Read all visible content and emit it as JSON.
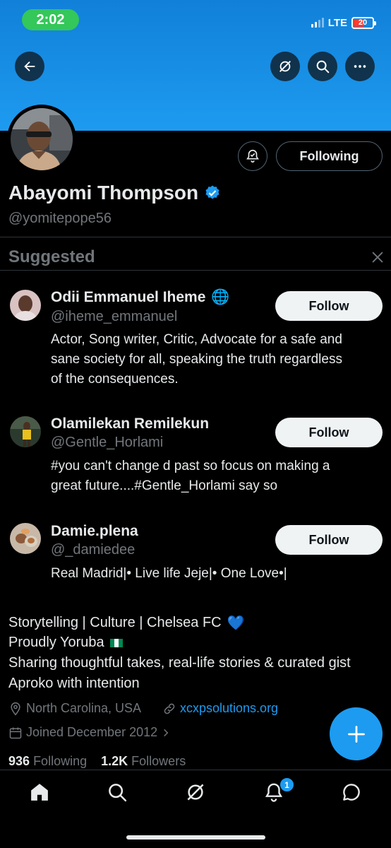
{
  "status_bar": {
    "time": "2:02",
    "network": "LTE",
    "battery": "20",
    "battery_color": "#ff3b30"
  },
  "header": {
    "back_icon": "arrow-left-icon",
    "actions": [
      "grok-icon",
      "search-icon",
      "more-icon"
    ]
  },
  "profile": {
    "name": "Abayomi Thompson",
    "verified": true,
    "handle": "@yomitepope56",
    "notify_icon": "bell-check-icon",
    "following_label": "Following"
  },
  "suggested": {
    "title": "Suggested",
    "items": [
      {
        "name": "Odii Emmanuel Iheme",
        "emoji": "🌐",
        "handle": "@iheme_emmanuel",
        "bio_lines": [
          "Actor, Song writer, Critic, Advocate for a safe and",
          "sane society for all, speaking the truth regardless",
          "of the consequences."
        ],
        "follow_label": "Follow"
      },
      {
        "name": "Olamilekan Remilekun",
        "emoji": "",
        "handle": "@Gentle_Horlami",
        "bio_lines": [
          "#you can't change d past so focus on making a",
          "great future....#Gentle_Horlami say so"
        ],
        "follow_label": "Follow"
      },
      {
        "name": "Damie.plena",
        "emoji": "",
        "handle": "@_damiedee",
        "bio_lines": [
          "Real Madrid|• Live life Jeje|• One Love•|"
        ],
        "follow_label": "Follow"
      }
    ]
  },
  "bio": {
    "line1": "Storytelling | Culture | Chelsea FC",
    "line1_emoji": "💙",
    "line2": "Proudly Yoruba",
    "line2_emoji": "🇳🇬",
    "line3": "Sharing thoughtful takes, real-life stories & curated gist",
    "line4": "Aproko with intention"
  },
  "meta": {
    "location": "North Carolina, USA",
    "website": "xcxpsolutions.org",
    "joined": "Joined December 2012"
  },
  "stats": {
    "following_count": "936",
    "following_label": "Following",
    "followers_count": "1.2K",
    "followers_label": "Followers"
  },
  "tabbar": {
    "tabs": [
      "home-icon",
      "search-icon",
      "grok-icon",
      "notifications-icon",
      "messages-icon"
    ],
    "notification_badge": "1"
  },
  "colors": {
    "accent": "#1d9bf0",
    "background": "#000000",
    "text_primary": "#e7e9ea",
    "text_secondary": "#71767b"
  }
}
